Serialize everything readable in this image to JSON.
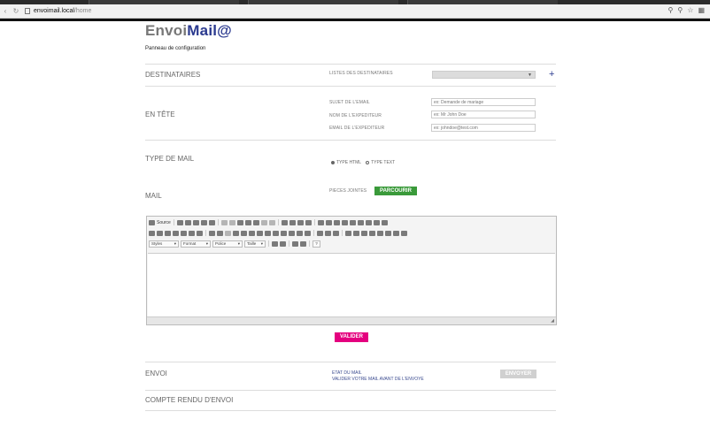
{
  "browser": {
    "url_host": "envoimail.local",
    "url_path": "/home",
    "icons": [
      "zoom-icon",
      "key-icon",
      "star-icon",
      "menu-icon"
    ]
  },
  "app": {
    "logo_part1": "Envoi",
    "logo_part2": "Mail@",
    "subtitle": "Panneau de configuration"
  },
  "destinataires": {
    "title": "DESTINATAIRES",
    "list_label": "LISTES DES DESTINATAIRES",
    "add_label": "+"
  },
  "entete": {
    "title": "EN TÊTE",
    "subject_label": "SUJET DE L'EMAIL",
    "subject_placeholder": "ex: Demande de mariage",
    "sender_name_label": "NOM DE L'EXPEDITEUR",
    "sender_name_placeholder": "ex: Mr John Doe",
    "sender_email_label": "EMAIL DE L'EXPEDITEUR",
    "sender_email_placeholder": "ex: johndoe@test.com"
  },
  "type_mail": {
    "title": "TYPE DE MAIL",
    "option_html": "TYPE HTML",
    "option_text": "TYPE TEXT",
    "selected": "TYPE HTML"
  },
  "mail": {
    "title": "MAIL",
    "attachments_label": "PIECES JOINTES",
    "browse_button": "PARCOURIR"
  },
  "editor": {
    "source_label": "Source",
    "styles_label": "Styles",
    "format_label": "Format",
    "font_label": "Police",
    "size_label": "Taille",
    "help_label": "?"
  },
  "actions": {
    "validate_button": "VALIDER"
  },
  "envoi": {
    "title": "ENVOI",
    "status_line1": "ETAT DU MAIL",
    "status_line2": "VALIDER VOTRE MAIL AVANT DE L'ENVOYE",
    "send_button": "ENVOYER"
  },
  "compte_rendu": {
    "title": "COMPTE RENDU D'ENVOI"
  }
}
